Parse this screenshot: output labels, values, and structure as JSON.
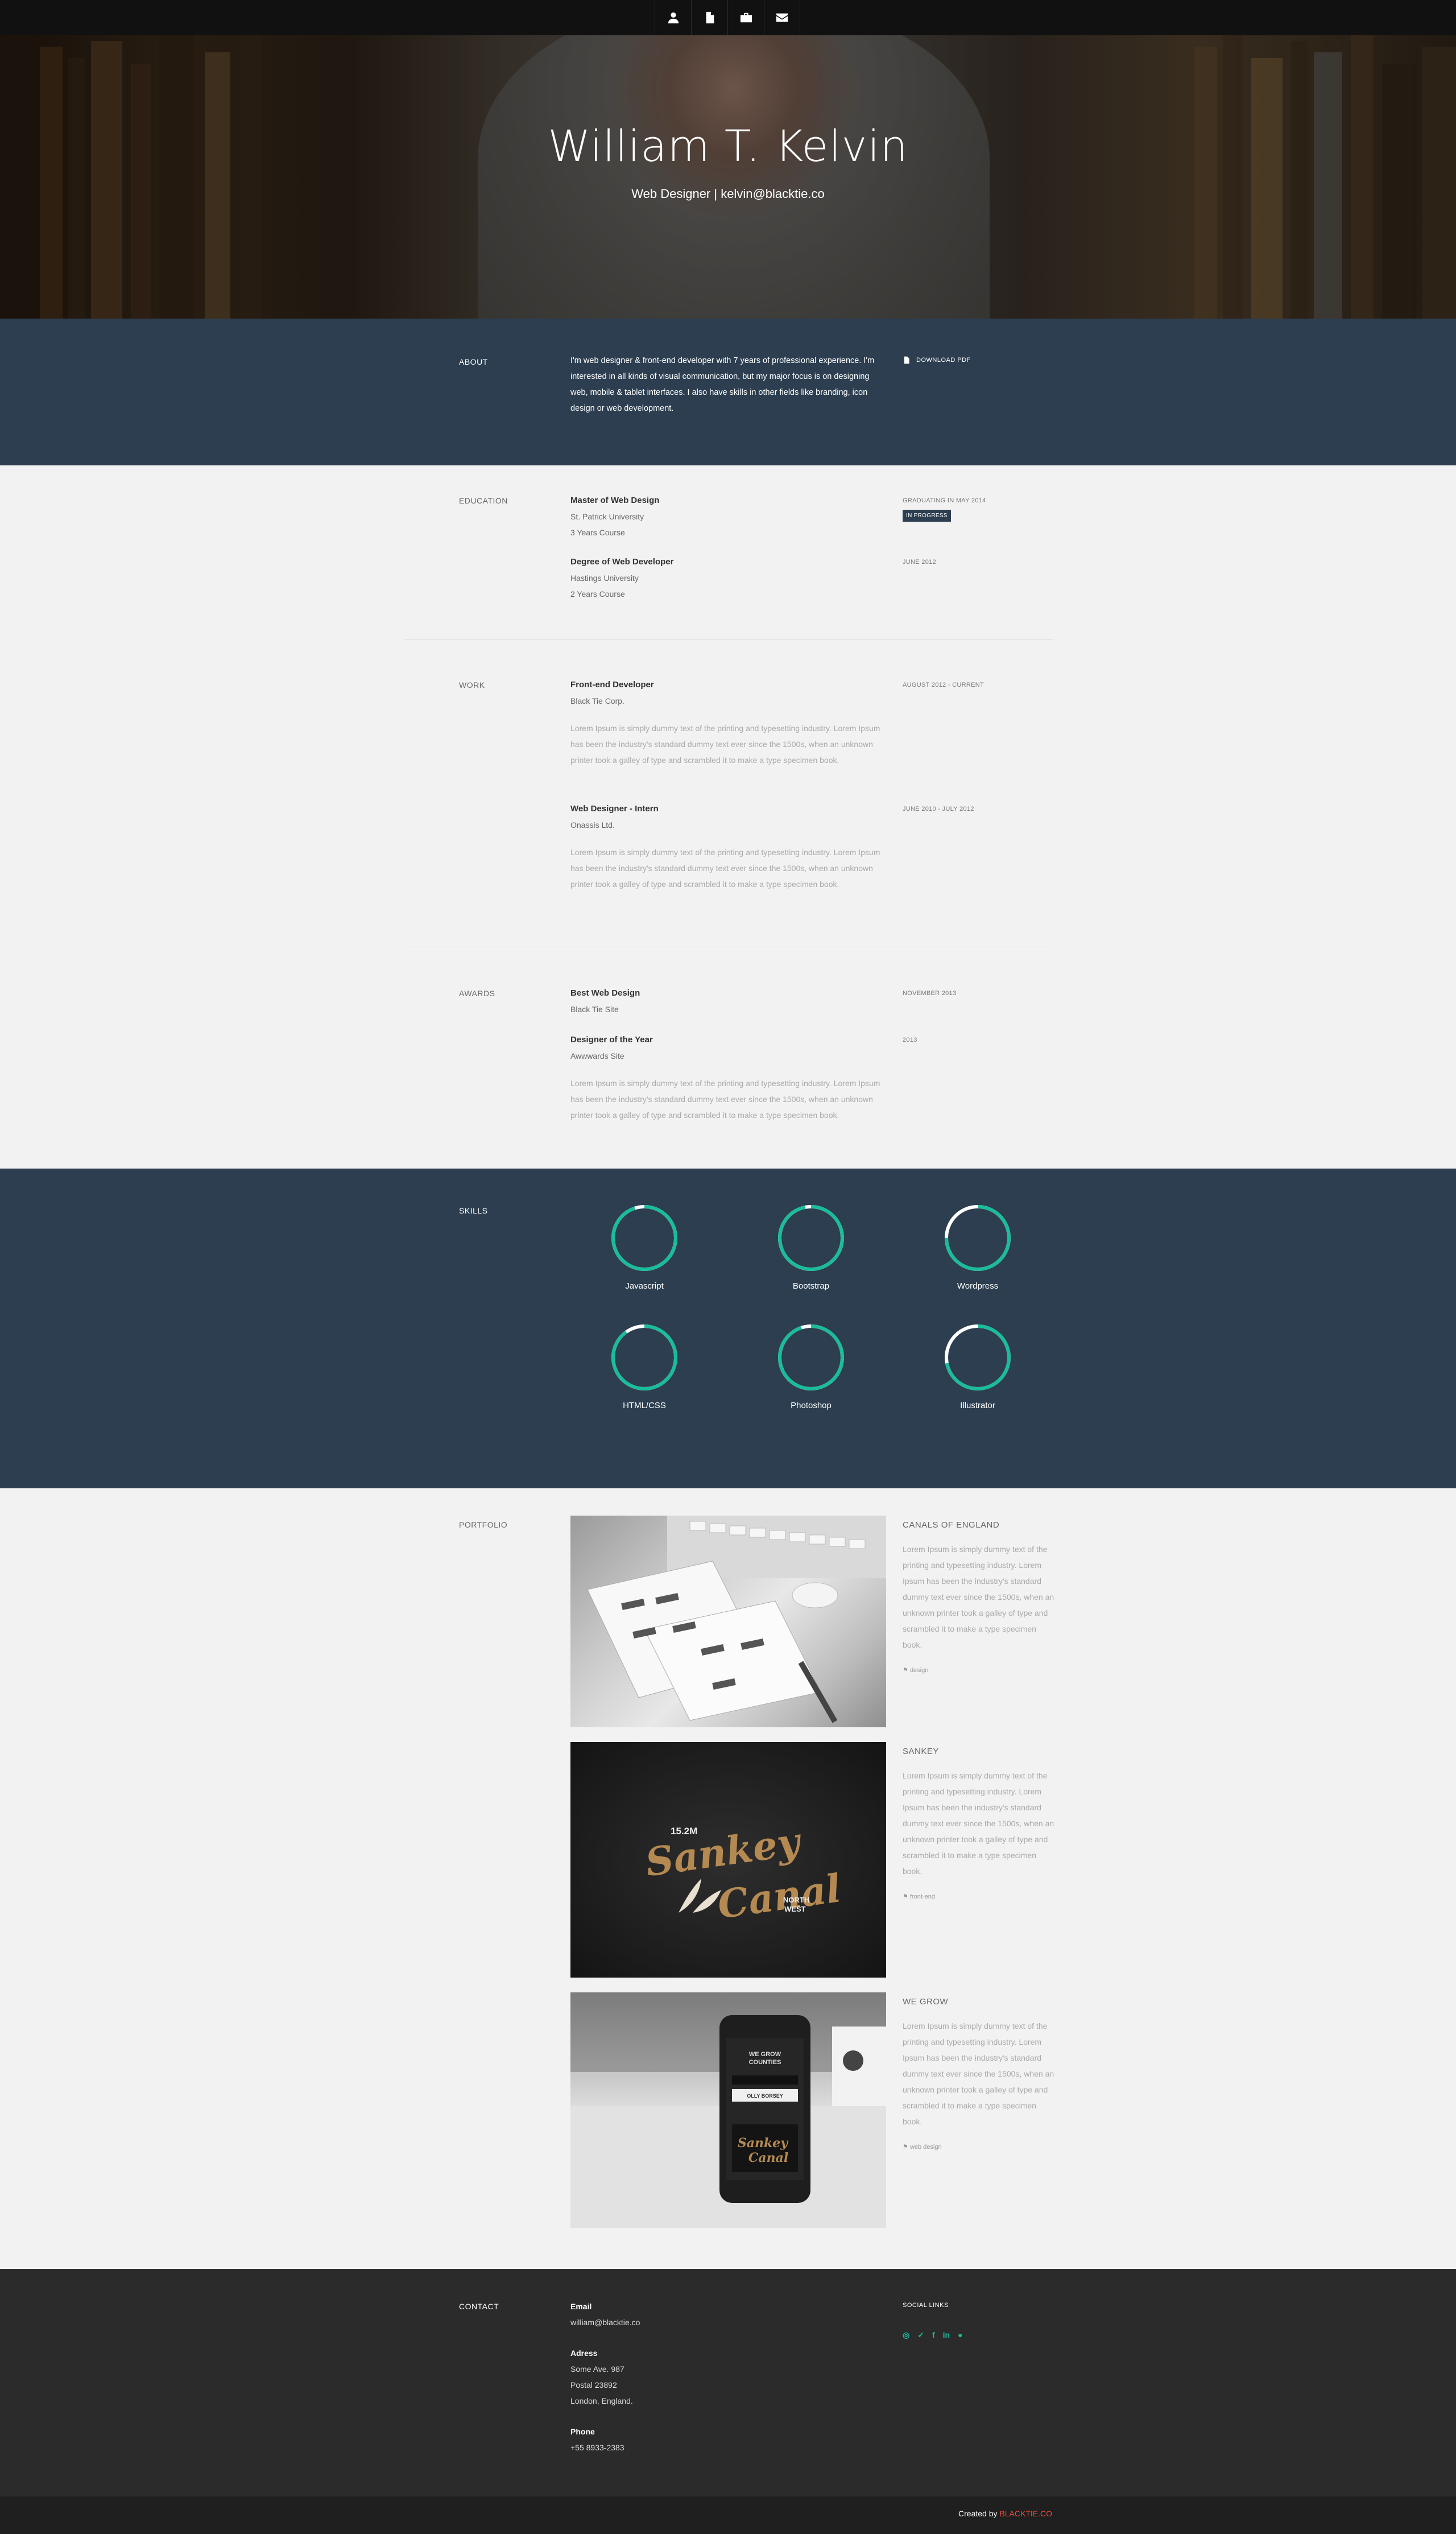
{
  "nav": {
    "icons": [
      "user-icon",
      "file-icon",
      "briefcase-icon",
      "envelope-icon"
    ]
  },
  "hero": {
    "name": "William T. Kelvin",
    "subtitle": "Web Designer | kelvin@blacktie.co"
  },
  "about": {
    "label": "ABOUT",
    "text": "I'm web designer & front-end developer with 7 years of professional experience. I'm interested in all kinds of visual communication, but my major focus is on designing web, mobile & tablet interfaces. I also have skills in other fields like branding, icon design or web development.",
    "download": "DOWNLOAD PDF"
  },
  "education": {
    "label": "EDUCATION",
    "items": [
      {
        "title": "Master of Web Design",
        "place": "St. Patrick University",
        "detail": "3 Years Course",
        "date": "GRADUATING IN MAY 2014",
        "badge": "IN PROGRESS"
      },
      {
        "title": "Degree of Web Developer",
        "place": "Hastings University",
        "detail": "2 Years Course",
        "date": "JUNE 2012"
      }
    ]
  },
  "work": {
    "label": "WORK",
    "items": [
      {
        "title": "Front-end Developer",
        "place": "Black Tie Corp.",
        "desc": "Lorem Ipsum is simply dummy text of the printing and typesetting industry. Lorem Ipsum has been the industry's standard dummy text ever since the 1500s, when an unknown printer took a galley of type and scrambled it to make a type specimen book.",
        "date": "AUGUST 2012 - CURRENT"
      },
      {
        "title": "Web Designer - Intern",
        "place": "Onassis Ltd.",
        "desc": "Lorem Ipsum is simply dummy text of the printing and typesetting industry. Lorem Ipsum has been the industry's standard dummy text ever since the 1500s, when an unknown printer took a galley of type and scrambled it to make a type specimen book.",
        "date": "JUNE 2010 - JULY 2012"
      }
    ]
  },
  "awards": {
    "label": "AWARDS",
    "items": [
      {
        "title": "Best Web Design",
        "place": "Black Tie Site",
        "date": "NOVEMBER 2013"
      },
      {
        "title": "Designer of the Year",
        "place": "Awwwards Site",
        "date": "2013"
      }
    ],
    "desc": "Lorem Ipsum is simply dummy text of the printing and typesetting industry. Lorem Ipsum has been the industry's standard dummy text ever since the 1500s, when an unknown printer took a galley of type and scrambled it to make a type specimen book."
  },
  "skills": {
    "label": "SKILLS",
    "accent": "#1abc9c",
    "items": [
      {
        "name": "Javascript",
        "level": 0.95
      },
      {
        "name": "Bootstrap",
        "level": 0.97
      },
      {
        "name": "Wordpress",
        "level": 0.75
      },
      {
        "name": "HTML/CSS",
        "level": 0.9
      },
      {
        "name": "Photoshop",
        "level": 0.95
      },
      {
        "name": "Illustrator",
        "level": 0.72
      }
    ]
  },
  "portfolio": {
    "label": "PORTFOLIO",
    "items": [
      {
        "title": "CANALS OF ENGLAND",
        "desc": "Lorem Ipsum is simply dummy text of the printing and typesetting industry. Lorem Ipsum has been the industry's standard dummy text ever since the 1500s, when an unknown printer took a galley of type and scrambled it to make a type specimen book.",
        "tag": "design"
      },
      {
        "title": "SANKEY",
        "desc": "Lorem Ipsum is simply dummy text of the printing and typesetting industry. Lorem Ipsum has been the industry's standard dummy text ever since the 1500s, when an unknown printer took a galley of type and scrambled it to make a type specimen book.",
        "tag": "front-end",
        "art_number": "15.2M",
        "art_title_1": "Sankey",
        "art_title_2": "Canal",
        "art_caption_1": "NORTH",
        "art_caption_2": "WEST"
      },
      {
        "title": "WE GROW",
        "desc": "Lorem Ipsum is simply dummy text of the printing and typesetting industry. Lorem Ipsum has been the industry's standard dummy text ever since the 1500s, when an unknown printer took a galley of type and scrambled it to make a type specimen book.",
        "tag": "web design",
        "phone_heading_1": "WE GROW",
        "phone_heading_2": "COUNTIES",
        "phone_button": "OLLY BORSEY",
        "phone_logo_1": "Sankey",
        "phone_logo_2": "Canal"
      }
    ]
  },
  "contact": {
    "label": "CONTACT",
    "email_label": "Email",
    "email": "william@blacktie.co",
    "address_label": "Adress",
    "address": [
      "Some Ave. 987",
      "Postal 23892",
      "London, England."
    ],
    "phone_label": "Phone",
    "phone": "+55 8933-2383",
    "social_label": "SOCIAL LINKS",
    "social": [
      "dribbble-icon",
      "twitter-icon",
      "facebook-icon",
      "linkedin-icon",
      "apple-icon"
    ]
  },
  "footer": {
    "created": "Created by",
    "brand": "BLACKTIE.CO"
  }
}
